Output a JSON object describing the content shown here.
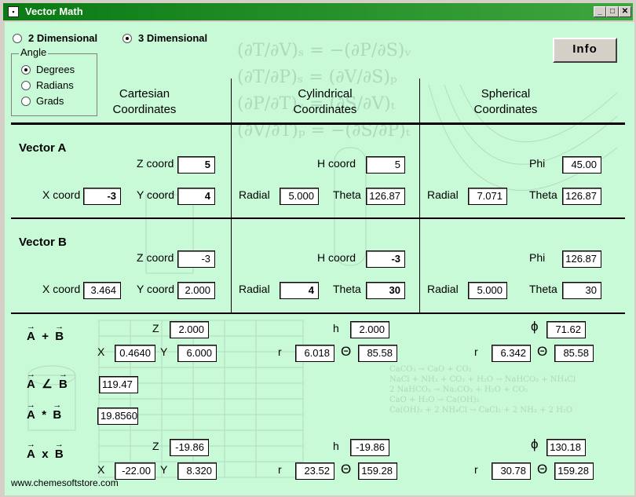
{
  "window": {
    "title": "Vector Math"
  },
  "dimension": {
    "opt2d": "2 Dimensional",
    "opt3d": "3 Dimensional",
    "selected": "3 Dimensional"
  },
  "angle": {
    "title": "Angle",
    "options": [
      "Degrees",
      "Radians",
      "Grads"
    ],
    "selected": "Degrees"
  },
  "info_label": "Info",
  "headers": {
    "cartesian": [
      "Cartesian",
      "Coordinates"
    ],
    "cylindrical": [
      "Cylindrical",
      "Coordinates"
    ],
    "spherical": [
      "Spherical",
      "Coordinates"
    ]
  },
  "labels": {
    "z_coord": "Z coord",
    "x_coord": "X coord",
    "y_coord": "Y coord",
    "h_coord": "H coord",
    "radial": "Radial",
    "theta": "Theta",
    "phi": "Phi",
    "Z": "Z",
    "X": "X",
    "Y": "Y",
    "h": "h",
    "r": "r",
    "theta_sym": "Θ",
    "phi_sym": "ϕ"
  },
  "vector_a": {
    "title": "Vector A",
    "z": "5",
    "x": "-3",
    "y": "4",
    "cyl_h": "5",
    "cyl_radial": "5.000",
    "cyl_theta": "126.87",
    "sph_phi": "45.00",
    "sph_radial": "7.071",
    "sph_theta": "126.87"
  },
  "vector_b": {
    "title": "Vector B",
    "z": "-3",
    "x": "3.464",
    "y": "2.000",
    "cyl_h": "-3",
    "cyl_radial": "4",
    "cyl_theta": "30",
    "sph_phi": "126.87",
    "sph_radial": "5.000",
    "sph_theta": "30"
  },
  "ops": {
    "sum": {
      "a": "A",
      "op": "+",
      "b": "B",
      "z": "2.000",
      "x": "0.4640",
      "y": "6.000",
      "h": "2.000",
      "r": "6.018",
      "theta": "85.58",
      "phi": "71.62",
      "sph_r": "6.342",
      "sph_theta": "85.58"
    },
    "angle": {
      "a": "A",
      "op": "∠",
      "b": "B",
      "value": "119.47"
    },
    "dot": {
      "a": "A",
      "op": "*",
      "b": "B",
      "value": "19.8560"
    },
    "cross": {
      "a": "A",
      "op": "x",
      "b": "B",
      "z": "-19.86",
      "x": "-22.00",
      "y": "8.320",
      "h": "-19.86",
      "r": "23.52",
      "theta": "159.28",
      "phi": "130.18",
      "sph_r": "30.78",
      "sph_theta": "159.28"
    }
  },
  "footer": "www.chemesoftstore.com"
}
